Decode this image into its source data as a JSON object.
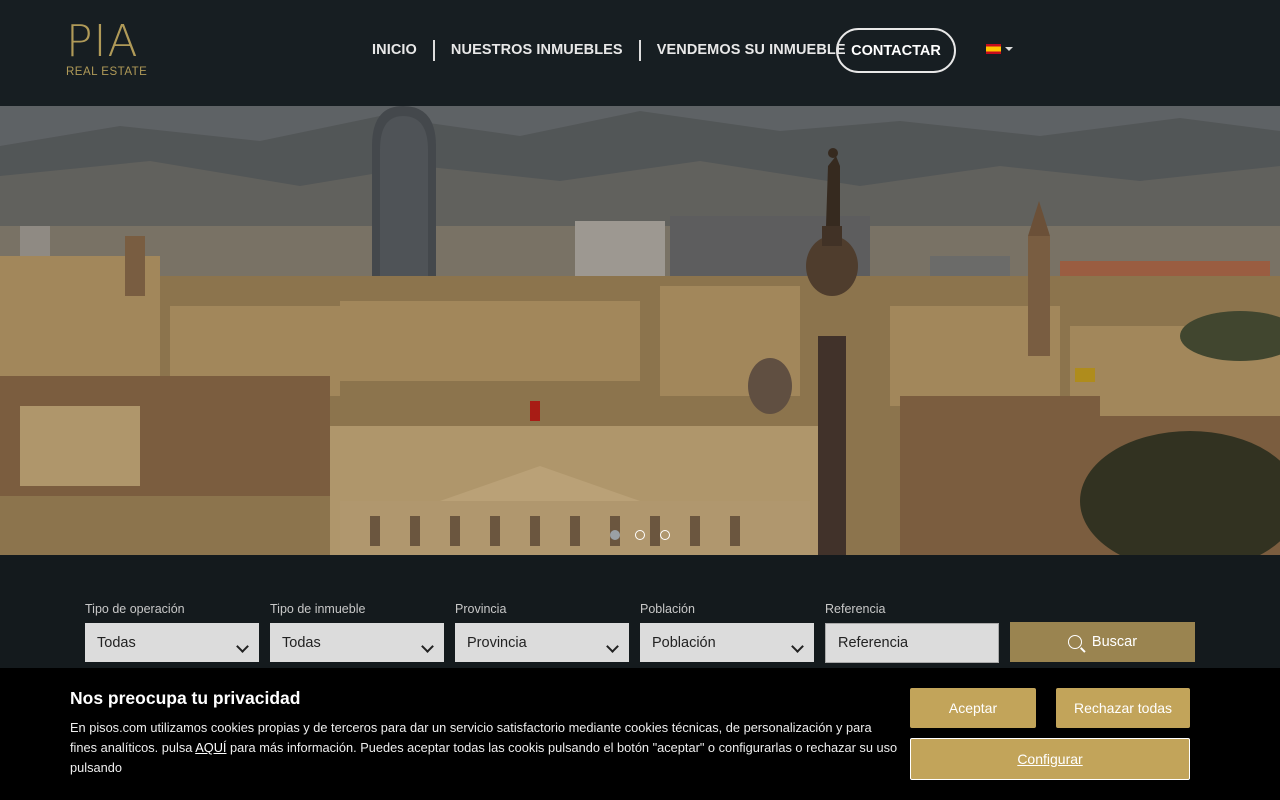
{
  "brand": {
    "logo_main": "PIA",
    "logo_sub": "REAL ESTATE",
    "accent_color": "#c2a45a"
  },
  "nav": {
    "items": [
      "INICIO",
      "NUESTROS INMUEBLES",
      "VENDEMOS SU INMUEBLE"
    ],
    "contact": "CONTACTAR",
    "language_icon": "spain-flag-icon"
  },
  "hero": {
    "slide_count": 3,
    "active_slide": 1
  },
  "search": {
    "fields": [
      {
        "label": "Tipo de operación",
        "value": "Todas"
      },
      {
        "label": "Tipo de inmueble",
        "value": "Todas"
      },
      {
        "label": "Provincia",
        "value": "Provincia"
      },
      {
        "label": "Población",
        "value": "Población"
      }
    ],
    "reference": {
      "label": "Referencia",
      "placeholder": "Referencia"
    },
    "button": "Buscar"
  },
  "cookie": {
    "title": "Nos preocupa tu privacidad",
    "text_before": "En pisos.com utilizamos cookies propias y de terceros para dar un servicio satisfactorio mediante cookies técnicas, de personalización y para fines analíticos. pulsa ",
    "link": "AQUÍ",
    "text_after": " para más información. Puedes aceptar todas las cookis pulsando el botón \"aceptar\" o configurarlas o rechazar su uso pulsando",
    "accept": "Aceptar",
    "reject": "Rechazar todas",
    "configure": "Configurar"
  }
}
